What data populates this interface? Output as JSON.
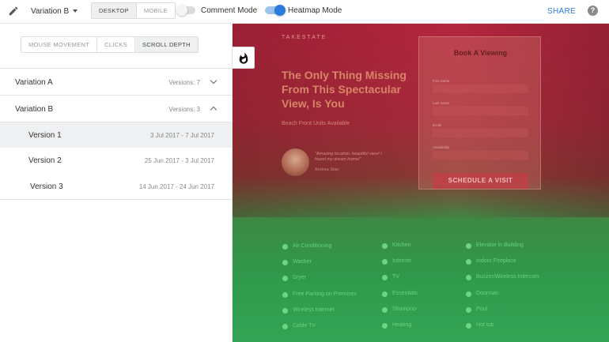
{
  "topbar": {
    "variant_select": "Variation B",
    "device_tabs": [
      "DESKTOP",
      "MOBILE"
    ],
    "comment_mode_label": "Comment Mode",
    "heatmap_mode_label": "Heatmap Mode",
    "share_label": "SHARE",
    "help_icon": "?"
  },
  "sidebar": {
    "mode_tabs": [
      "MOUSE MOVEMENT",
      "CLICKS",
      "SCROLL DEPTH"
    ],
    "variations": [
      {
        "name": "Variation A",
        "versions": "Versions: 7"
      },
      {
        "name": "Variation B",
        "versions": "Versions: 3"
      }
    ],
    "versions": [
      {
        "name": "Version 1",
        "dates": "3 Jul 2017 - 7 Jul 2017"
      },
      {
        "name": "Version 2",
        "dates": "25 Jun 2017 - 3 Jul 2017"
      },
      {
        "name": "Version 3",
        "dates": "14 Jun 2017 - 24 Jun 2017"
      }
    ]
  },
  "preview": {
    "logo": "TAKESTATE",
    "hero_title": "The Only Thing Missing From This Spectacular View, Is You",
    "hero_sub": "Beach Front Units Available",
    "quote": "\"Amazing location, beautiful view! I found my dream home!\"",
    "quote_author": "Andrea Stan",
    "card_title": "Book A Viewing",
    "fields": [
      "First name",
      "Last name",
      "Email",
      "Availability"
    ],
    "card_button": "SCHEDULE A VISIT",
    "amenities_col1": [
      "Air Conditioning",
      "Washer",
      "Dryer",
      "Free Parking on Premises",
      "Wireless Internet",
      "Cable TV"
    ],
    "amenities_col2": [
      "Kitchen",
      "Internet",
      "TV",
      "Essentials",
      "Shampoo",
      "Heating"
    ],
    "amenities_col3": [
      "Elevator in Building",
      "Indoor Fireplace",
      "Buzzer/Wireless Intercom",
      "Doorman",
      "Pool",
      "Hot tub"
    ]
  },
  "colors": {
    "accent": "#2b7ae0",
    "heat_hot": "#b4263f",
    "heat_cold": "#33a354"
  }
}
